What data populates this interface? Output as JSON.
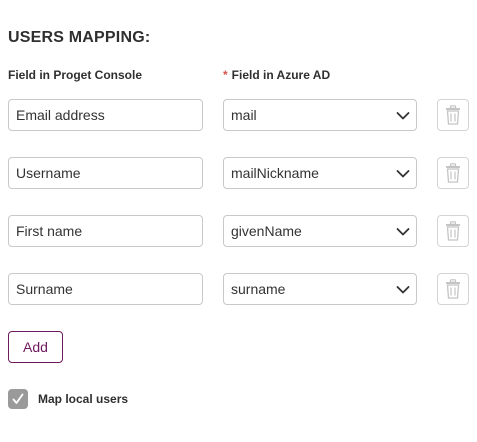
{
  "section": {
    "title": "USERS MAPPING:"
  },
  "columns": {
    "left_label": "Field in Proget Console",
    "right_required_marker": "*",
    "right_label": "Field in Azure AD"
  },
  "mappings": [
    {
      "console_field": "Email address",
      "azure_field": "mail"
    },
    {
      "console_field": "Username",
      "azure_field": "mailNickname"
    },
    {
      "console_field": "First name",
      "azure_field": "givenName"
    },
    {
      "console_field": "Surname",
      "azure_field": "surname"
    }
  ],
  "actions": {
    "add_label": "Add"
  },
  "options": {
    "map_local_users_label": "Map local users",
    "map_local_users_checked": true
  },
  "colors": {
    "accent": "#6d1a5c",
    "required": "#d9534f",
    "checkbox_fill": "#9a9a9a",
    "icon_disabled": "#c4c4c4"
  },
  "icons": {
    "dropdown": "chevron-down-icon",
    "delete": "trash-icon",
    "check": "checkmark-icon"
  }
}
